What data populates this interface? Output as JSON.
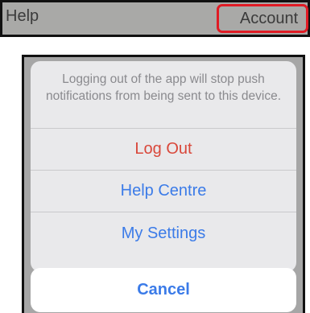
{
  "tabs": {
    "help_label": "Help",
    "account_label": "Account"
  },
  "action_sheet": {
    "message": "Logging out of the app will stop push notifications from being sent to this device.",
    "actions": [
      {
        "label": "Log Out",
        "color": "#d9473a"
      },
      {
        "label": "Help Centre",
        "color": "#3b7be8"
      },
      {
        "label": "My Settings",
        "color": "#3b7be8"
      }
    ],
    "cancel_label": "Cancel",
    "cancel_color": "#3b7be8"
  }
}
